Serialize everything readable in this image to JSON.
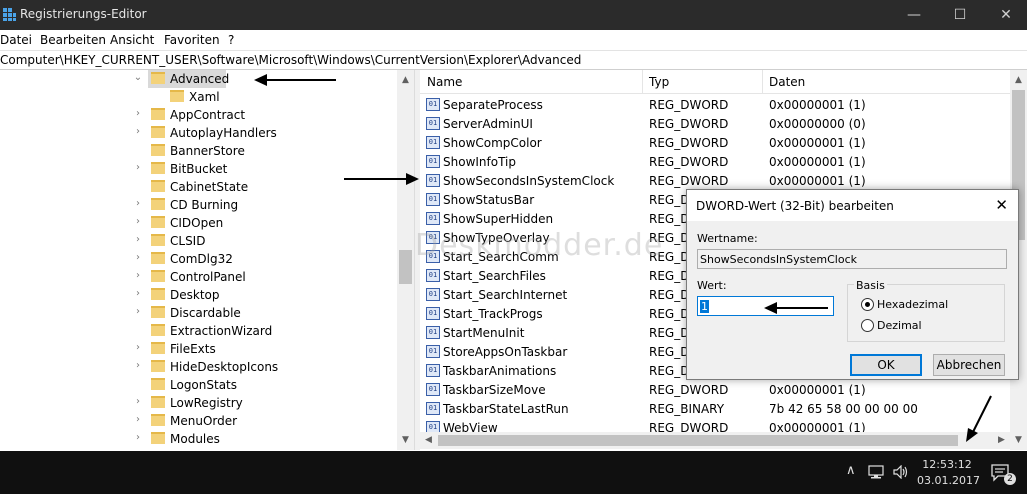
{
  "window": {
    "title": "Registrierungs-Editor",
    "minimize": "—",
    "maximize": "☐",
    "close": "✕"
  },
  "menu": [
    "Datei",
    "Bearbeiten",
    "Ansicht",
    "Favoriten",
    "?"
  ],
  "address": {
    "path": "Computer\\HKEY_CURRENT_USER\\Software\\Microsoft\\Windows\\CurrentVersion\\Explorer\\Advanced"
  },
  "tree": {
    "items": [
      {
        "label": "Advanced",
        "expanded": true,
        "selected": true
      },
      {
        "label": "Xaml",
        "child": true
      },
      {
        "label": "AppContract"
      },
      {
        "label": "AutoplayHandlers"
      },
      {
        "label": "BannerStore"
      },
      {
        "label": "BitBucket"
      },
      {
        "label": "CabinetState"
      },
      {
        "label": "CD Burning"
      },
      {
        "label": "CIDOpen"
      },
      {
        "label": "CLSID"
      },
      {
        "label": "ComDlg32"
      },
      {
        "label": "ControlPanel"
      },
      {
        "label": "Desktop"
      },
      {
        "label": "Discardable"
      },
      {
        "label": "ExtractionWizard"
      },
      {
        "label": "FileExts"
      },
      {
        "label": "HideDesktopIcons"
      },
      {
        "label": "LogonStats"
      },
      {
        "label": "LowRegistry"
      },
      {
        "label": "MenuOrder"
      },
      {
        "label": "Modules"
      }
    ]
  },
  "list": {
    "columns": {
      "name": "Name",
      "type": "Typ",
      "data": "Daten"
    },
    "rows": [
      {
        "name": "SeparateProcess",
        "type": "REG_DWORD",
        "data": "0x00000001 (1)"
      },
      {
        "name": "ServerAdminUI",
        "type": "REG_DWORD",
        "data": "0x00000000 (0)"
      },
      {
        "name": "ShowCompColor",
        "type": "REG_DWORD",
        "data": "0x00000001 (1)"
      },
      {
        "name": "ShowInfoTip",
        "type": "REG_DWORD",
        "data": "0x00000001 (1)"
      },
      {
        "name": "ShowSecondsInSystemClock",
        "type": "REG_DWORD",
        "data": "0x00000001 (1)"
      },
      {
        "name": "ShowStatusBar",
        "type": "REG_DV",
        "data": ""
      },
      {
        "name": "ShowSuperHidden",
        "type": "REG_DV",
        "data": ""
      },
      {
        "name": "ShowTypeOverlay",
        "type": "REG_DV",
        "data": ""
      },
      {
        "name": "Start_SearchComm",
        "type": "REG_DV",
        "data": ""
      },
      {
        "name": "Start_SearchFiles",
        "type": "REG_DV",
        "data": ""
      },
      {
        "name": "Start_SearchInternet",
        "type": "REG_DV",
        "data": ""
      },
      {
        "name": "Start_TrackProgs",
        "type": "REG_DV",
        "data": ""
      },
      {
        "name": "StartMenuInit",
        "type": "REG_DV",
        "data": ""
      },
      {
        "name": "StoreAppsOnTaskbar",
        "type": "REG_DV",
        "data": ""
      },
      {
        "name": "TaskbarAnimations",
        "type": "REG_DV",
        "data": ""
      },
      {
        "name": "TaskbarSizeMove",
        "type": "REG_DWORD",
        "data": "0x00000001 (1)"
      },
      {
        "name": "TaskbarStateLastRun",
        "type": "REG_BINARY",
        "data": "7b 42 65 58 00 00 00 00"
      },
      {
        "name": "WebView",
        "type": "REG_DWORD",
        "data": "0x00000001 (1)"
      }
    ]
  },
  "watermark": "Deskmodder.de",
  "dialog": {
    "title": "DWORD-Wert (32-Bit) bearbeiten",
    "close": "✕",
    "name_label": "Wertname:",
    "name_value": "ShowSecondsInSystemClock",
    "value_label": "Wert:",
    "value": "1",
    "base_label": "Basis",
    "hex_label": "Hexadezimal",
    "dec_label": "Dezimal",
    "ok": "OK",
    "cancel": "Abbrechen"
  },
  "taskbar": {
    "time": "12:53:12",
    "date": "03.01.2017",
    "notifications": "2"
  }
}
